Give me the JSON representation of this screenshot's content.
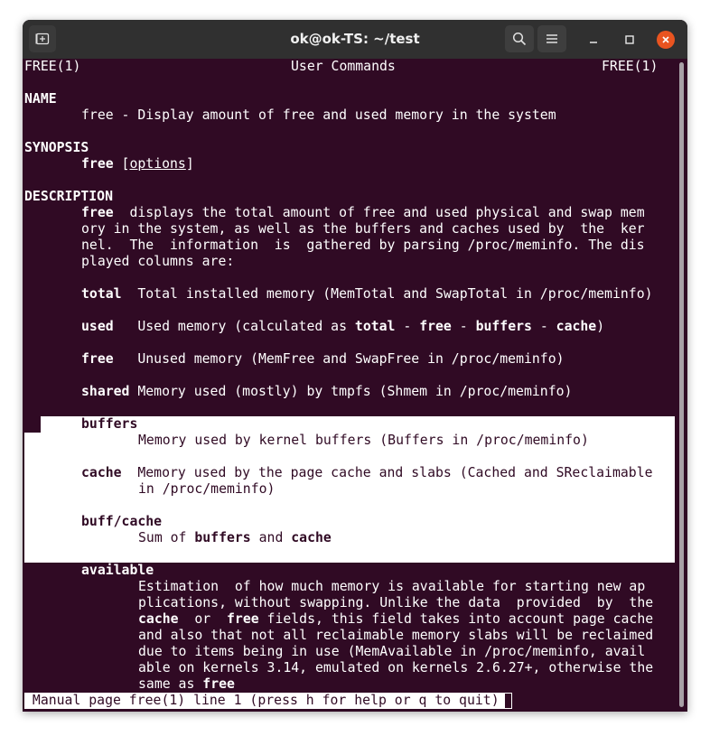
{
  "window": {
    "title": "ok@ok-TS: ~/test"
  },
  "icons": {
    "new_tab": "new-tab-icon",
    "search": "search-icon",
    "menu": "hamburger-menu-icon",
    "minimize": "minimize-icon",
    "maximize": "maximize-icon",
    "close": "close-icon"
  },
  "colors": {
    "terminal_bg": "#300a24",
    "titlebar_bg": "#303030",
    "close_button": "#e95420"
  },
  "man": {
    "header_left": "FREE(1)",
    "header_center": "User Commands",
    "header_right": "FREE(1)",
    "name_heading": "NAME",
    "name_text": "free - Display amount of free and used memory in the system",
    "synopsis_heading": "SYNOPSIS",
    "synopsis_cmd": "free",
    "synopsis_options": "options",
    "description_heading": "DESCRIPTION",
    "desc_cmd": "free",
    "desc_line1": "  displays the total amount of free and used physical and swap mem",
    "desc_line2": "ory in the system, as well as the buffers and caches used by  the  ker",
    "desc_line3": "nel.  The  information  is  gathered by parsing /proc/meminfo. The dis",
    "desc_line4": "played columns are:",
    "total_label": "total",
    "total_text": "  Total installed memory (MemTotal and SwapTotal in /proc/meminfo)",
    "used_label": "used",
    "used_text1": "   Used memory (calculated as ",
    "used_b_total": "total",
    "used_sep1": " - ",
    "used_b_free": "free",
    "used_sep2": " - ",
    "used_b_buffers": "buffers",
    "used_sep3": " - ",
    "used_b_cache": "cache",
    "used_close": ")",
    "free_label": "free",
    "free_text": "   Unused memory (MemFree and SwapFree in /proc/meminfo)",
    "shared_label": "shared",
    "shared_text": " Memory used (mostly) by tmpfs (Shmem in /proc/meminfo)",
    "buffers_label": "buffers",
    "buffers_text": "Memory used by kernel buffers (Buffers in /proc/meminfo)",
    "cache_label": "cache",
    "cache_text1": "  Memory used by the page cache and slabs (Cached and SReclaimable",
    "cache_text2": "in /proc/meminfo)",
    "buffcache_label": "buff/cache",
    "buffcache_text1": "Sum of ",
    "buffcache_b_buffers": "buffers",
    "buffcache_and": " and ",
    "buffcache_b_cache": "cache",
    "available_label": "available",
    "avail_line1": "Estimation  of how much memory is available for starting new ap",
    "avail_line2": "plications, without swapping. Unlike the data  provided  by  the",
    "avail_b_cache": "cache",
    "avail_or": "  or  ",
    "avail_b_free": "free",
    "avail_line3_rest": " fields, this field takes into account page cache",
    "avail_line4": "and also that not all reclaimable memory slabs will be reclaimed",
    "avail_line5": "due to items being in use (MemAvailable in /proc/meminfo, avail",
    "avail_line6": "able on kernels 3.14, emulated on kernels 2.6.27+, otherwise the",
    "avail_line7": "same as ",
    "avail_b_free2": "free",
    "status": " Manual page free(1) line 1 (press h for help or q to quit)"
  }
}
